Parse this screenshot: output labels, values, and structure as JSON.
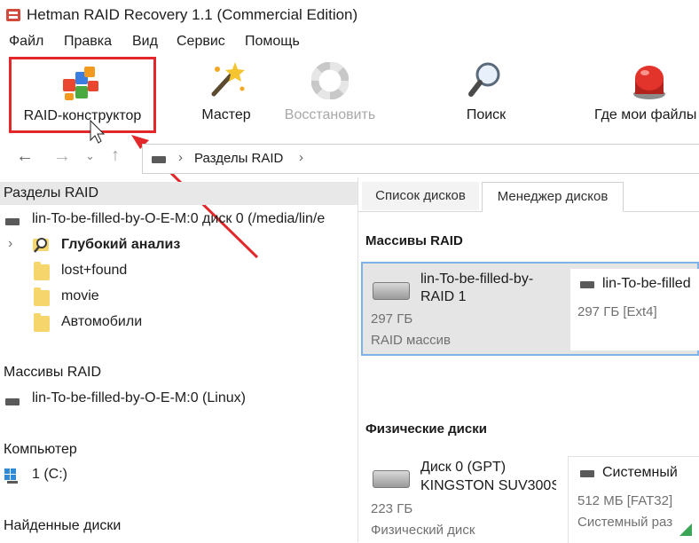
{
  "window": {
    "title": "Hetman RAID Recovery 1.1 (Commercial Edition)"
  },
  "menu": [
    "Файл",
    "Правка",
    "Вид",
    "Сервис",
    "Помощь"
  ],
  "toolbar": {
    "raid_constructor": "RAID-конструктор",
    "wizard": "Мастер",
    "restore": "Восстановить",
    "search": "Поиск",
    "where_files": "Где мои файлы"
  },
  "nav": {
    "breadcrumb": "Разделы RAID"
  },
  "left": {
    "raid_partitions_header": "Разделы RAID",
    "raid_disk": "lin-To-be-filled-by-O-E-M:0 диск 0 (/media/lin/e",
    "deep_analysis": "Глубокий анализ",
    "folders": [
      "lost+found",
      "movie",
      "Автомобили"
    ],
    "raid_arrays_header": "Массивы RAID",
    "raid_array": "lin-To-be-filled-by-O-E-M:0 (Linux)",
    "computer_header": "Компьютер",
    "computer_drive": "1 (C:)",
    "found_disks_header": "Найденные диски"
  },
  "right": {
    "tabs": [
      "Список дисков",
      "Менеджер дисков"
    ],
    "raid_arrays_title": "Массивы RAID",
    "raid_card": {
      "name_line1": "lin-To-be-filled-by-",
      "name_line2": "RAID 1",
      "size": "297 ГБ",
      "type": "RAID массив"
    },
    "raid_part_card": {
      "name": "lin-To-be-filled",
      "size": "297 ГБ [Ext4]"
    },
    "physical_title": "Физические диски",
    "disk_card": {
      "name_line1": "Диск 0 (GPT)",
      "name_line2": "KINGSTON SUV300S",
      "size": "223 ГБ",
      "type": "Физический диск"
    },
    "system_card": {
      "name": "Системный",
      "size": "512 МБ [FAT32]",
      "type": "Системный раз"
    }
  },
  "colors": {
    "highlight_red": "#e3282b",
    "selected_card": "#e5e5e5",
    "section_header": "#f0f0f0"
  }
}
